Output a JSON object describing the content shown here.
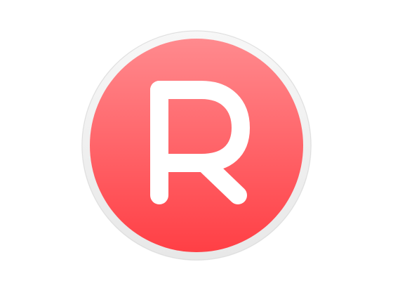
{
  "icon": {
    "name": "r-logo-icon",
    "letter": "R",
    "colors": {
      "ring": "#f1f1f1",
      "ring_shadow": "#e2e2e2",
      "fill_top": "#ff8a8e",
      "fill_bottom": "#ff3f45",
      "letter": "#ffffff"
    }
  }
}
